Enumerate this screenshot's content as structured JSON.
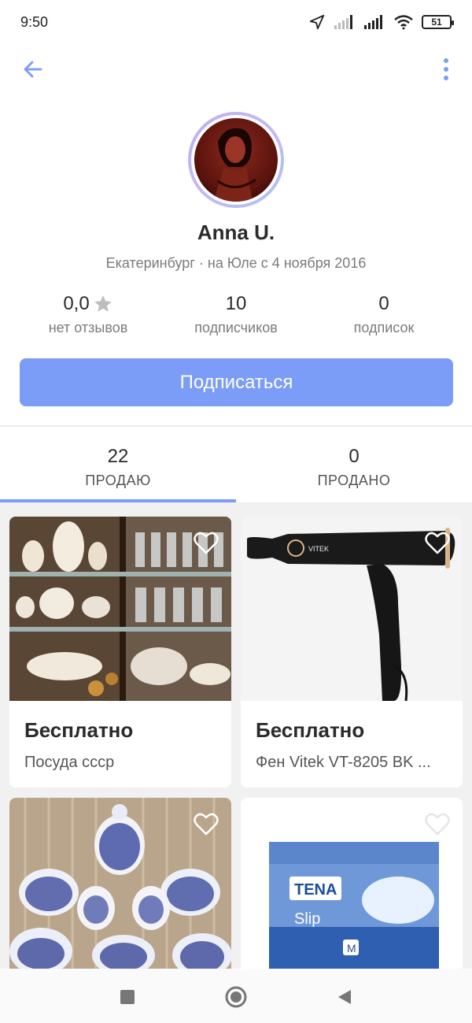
{
  "status_bar": {
    "time": "9:50",
    "battery": "51",
    "icons": [
      "location-arrow-icon",
      "signal-icon",
      "signal-icon",
      "wifi-icon",
      "battery-icon"
    ]
  },
  "app_bar": {
    "back_icon": "arrow-left-icon",
    "menu_icon": "more-vertical-icon"
  },
  "profile": {
    "name": "Anna U.",
    "meta": "Екатеринбург · на Юле с 4 ноября 2016",
    "stats": [
      {
        "value": "0,0",
        "label": "нет отзывов",
        "icon": "star-icon"
      },
      {
        "value": "10",
        "label": "подписчиков"
      },
      {
        "value": "0",
        "label": "подписок"
      }
    ],
    "subscribe_label": "Подписаться"
  },
  "tabs": [
    {
      "count": "22",
      "label": "ПРОДАЮ",
      "active": true
    },
    {
      "count": "0",
      "label": "ПРОДАНО",
      "active": false
    }
  ],
  "listings": [
    {
      "price": "Бесплатно",
      "title": "Посуда ссср",
      "image": "china-cabinet-photo"
    },
    {
      "price": "Бесплатно",
      "title": "Фен Vitek VT-8205 BK ...",
      "image": "hair-dryer-photo"
    },
    {
      "price": "",
      "title": "",
      "image": "blue-porcelain-photo"
    },
    {
      "price": "",
      "title": "",
      "image": "tena-slip-package-photo"
    }
  ],
  "colors": {
    "accent": "#7b9cf7",
    "text_primary": "#2b2b2b",
    "text_secondary": "#7a7a7a",
    "grid_background": "#f1f1f1"
  },
  "nav_bar": {
    "icons": [
      "recents-square-icon",
      "home-circle-icon",
      "back-triangle-icon"
    ]
  }
}
